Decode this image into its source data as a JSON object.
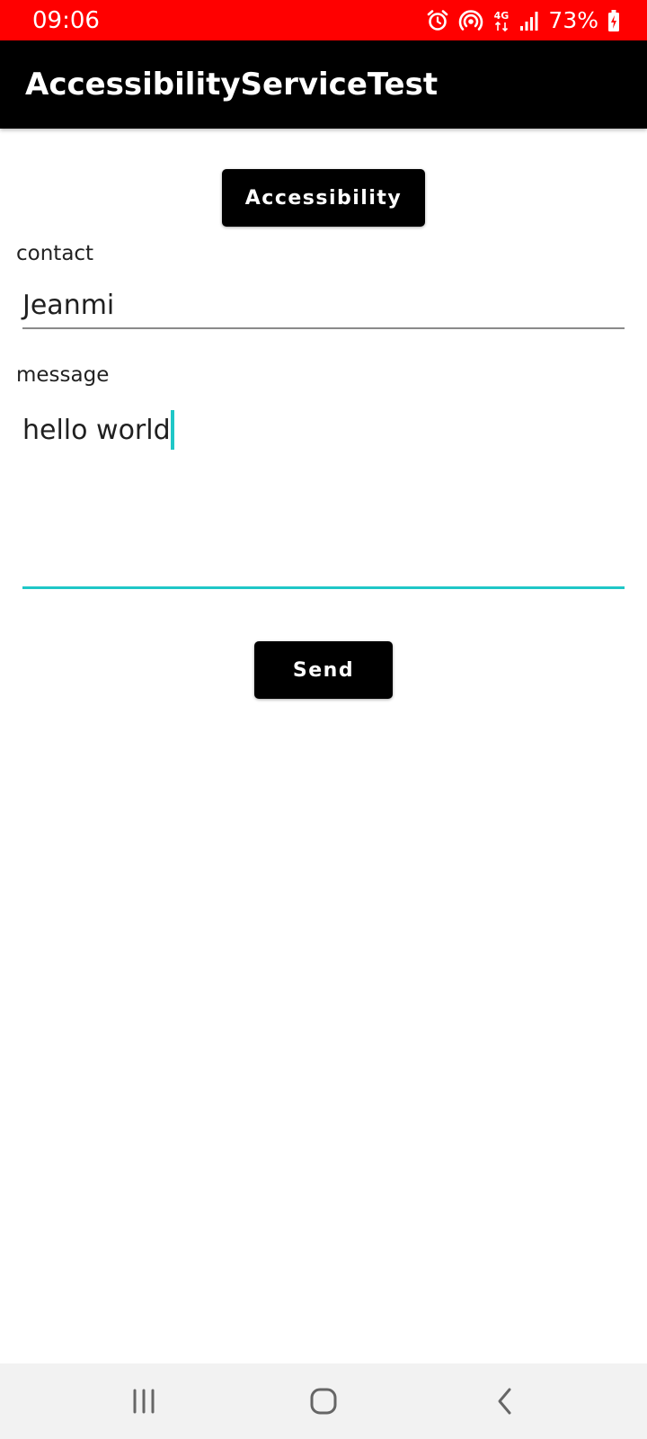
{
  "status_bar": {
    "time": "09:06",
    "battery": "73%",
    "icons": [
      "alarm-icon",
      "hotspot-icon",
      "network-4g-icon",
      "signal-icon",
      "battery-charging-icon"
    ],
    "network_label": "4G",
    "background_color": "#ff0000"
  },
  "app_bar": {
    "title": "AccessibilityServiceTest",
    "background_color": "#000000"
  },
  "main": {
    "accessibility_button_label": "Accessibility",
    "contact_label": "contact",
    "contact_value": "Jeanmi",
    "message_label": "message",
    "message_value": "hello world",
    "send_button_label": "Send",
    "accent_color": "#1fc7c7"
  },
  "nav_bar": {
    "icons": [
      "recent-apps-icon",
      "home-icon",
      "back-icon"
    ]
  }
}
